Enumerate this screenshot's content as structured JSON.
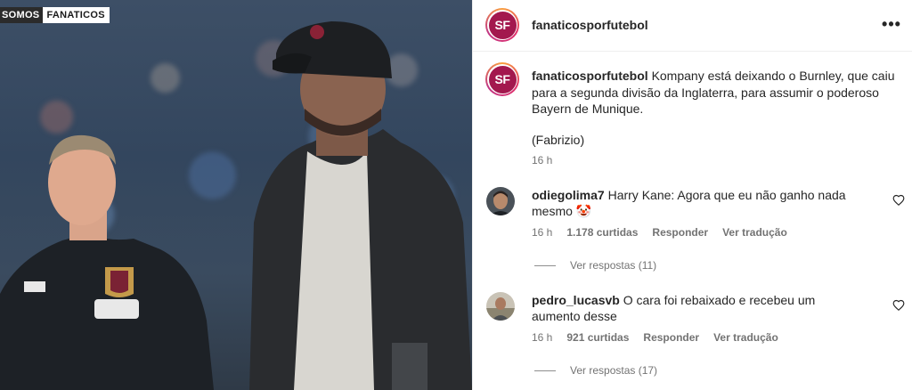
{
  "media": {
    "brand_logo_part1": "SOMOS",
    "brand_logo_part2": "FANATICOS"
  },
  "header": {
    "avatar_initials": "SF",
    "username": "fanaticosporfutebol",
    "more_label": "•••"
  },
  "caption": {
    "avatar_initials": "SF",
    "username": "fanaticosporfutebol",
    "text": "Kompany está deixando o Burnley, que caiu para a segunda divisão da Inglaterra, para assumir o poderoso Bayern de Munique.",
    "source": "(Fabrizio)",
    "time": "16 h"
  },
  "comments": [
    {
      "username": "odiegolima7",
      "text": "Harry Kane: Agora que eu não ganho nada mesmo 🤡",
      "time": "16 h",
      "likes": "1.178 curtidas",
      "reply": "Responder",
      "translate": "Ver tradução",
      "view_replies": "Ver respostas (11)"
    },
    {
      "username": "pedro_lucasvb",
      "text": "O cara foi rebaixado e recebeu um aumento desse",
      "time": "16 h",
      "likes": "921 curtidas",
      "reply": "Responder",
      "translate": "Ver tradução",
      "view_replies": "Ver respostas (17)"
    }
  ],
  "colors": {
    "text_primary": "#262626",
    "text_secondary": "#737373",
    "brand_maroon": "#a3184e",
    "divider": "#efefef"
  },
  "icons": {
    "more": "more-options-icon",
    "heart": "heart-icon"
  }
}
